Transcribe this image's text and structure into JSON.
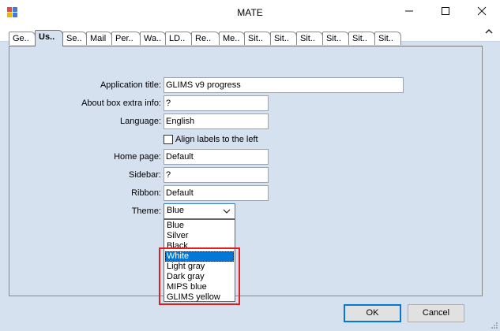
{
  "window": {
    "title": "MATE",
    "minimize_label": "—",
    "maximize_label": "☐",
    "close_label": "✕"
  },
  "tabs": [
    {
      "label": "Ge..",
      "active": false
    },
    {
      "label": "Us..",
      "active": true
    },
    {
      "label": "Se..",
      "active": false
    },
    {
      "label": "Mail",
      "active": false
    },
    {
      "label": "Per..",
      "active": false
    },
    {
      "label": "Wa..",
      "active": false
    },
    {
      "label": "LD..",
      "active": false
    },
    {
      "label": "Re..",
      "active": false
    },
    {
      "label": "Me..",
      "active": false
    },
    {
      "label": "Sit..",
      "active": false
    },
    {
      "label": "Sit..",
      "active": false
    },
    {
      "label": "Sit..",
      "active": false
    },
    {
      "label": "Sit..",
      "active": false
    },
    {
      "label": "Sit..",
      "active": false
    },
    {
      "label": "Sit..",
      "active": false
    }
  ],
  "form": {
    "application_title": {
      "label": "Application title:",
      "value": "GLIMS v9 progress"
    },
    "about_box": {
      "label": "About box extra info:",
      "value": "?"
    },
    "language": {
      "label": "Language:",
      "value": "English"
    },
    "align_labels": {
      "label": "Align labels to the left",
      "checked": false
    },
    "home_page": {
      "label": "Home page:",
      "value": "Default"
    },
    "sidebar": {
      "label": "Sidebar:",
      "value": "?"
    },
    "ribbon": {
      "label": "Ribbon:",
      "value": "Default"
    },
    "theme": {
      "label": "Theme:",
      "value": "Blue",
      "options": [
        "Blue",
        "Silver",
        "Black",
        "White",
        "Light gray",
        "Dark gray",
        "MIPS blue",
        "GLIMS yellow"
      ],
      "selected_index": 3
    }
  },
  "buttons": {
    "ok": "OK",
    "cancel": "Cancel"
  },
  "colors": {
    "accent": "#0078d7",
    "highlight_box": "#e02020",
    "client_bg": "#d6e1ef"
  }
}
